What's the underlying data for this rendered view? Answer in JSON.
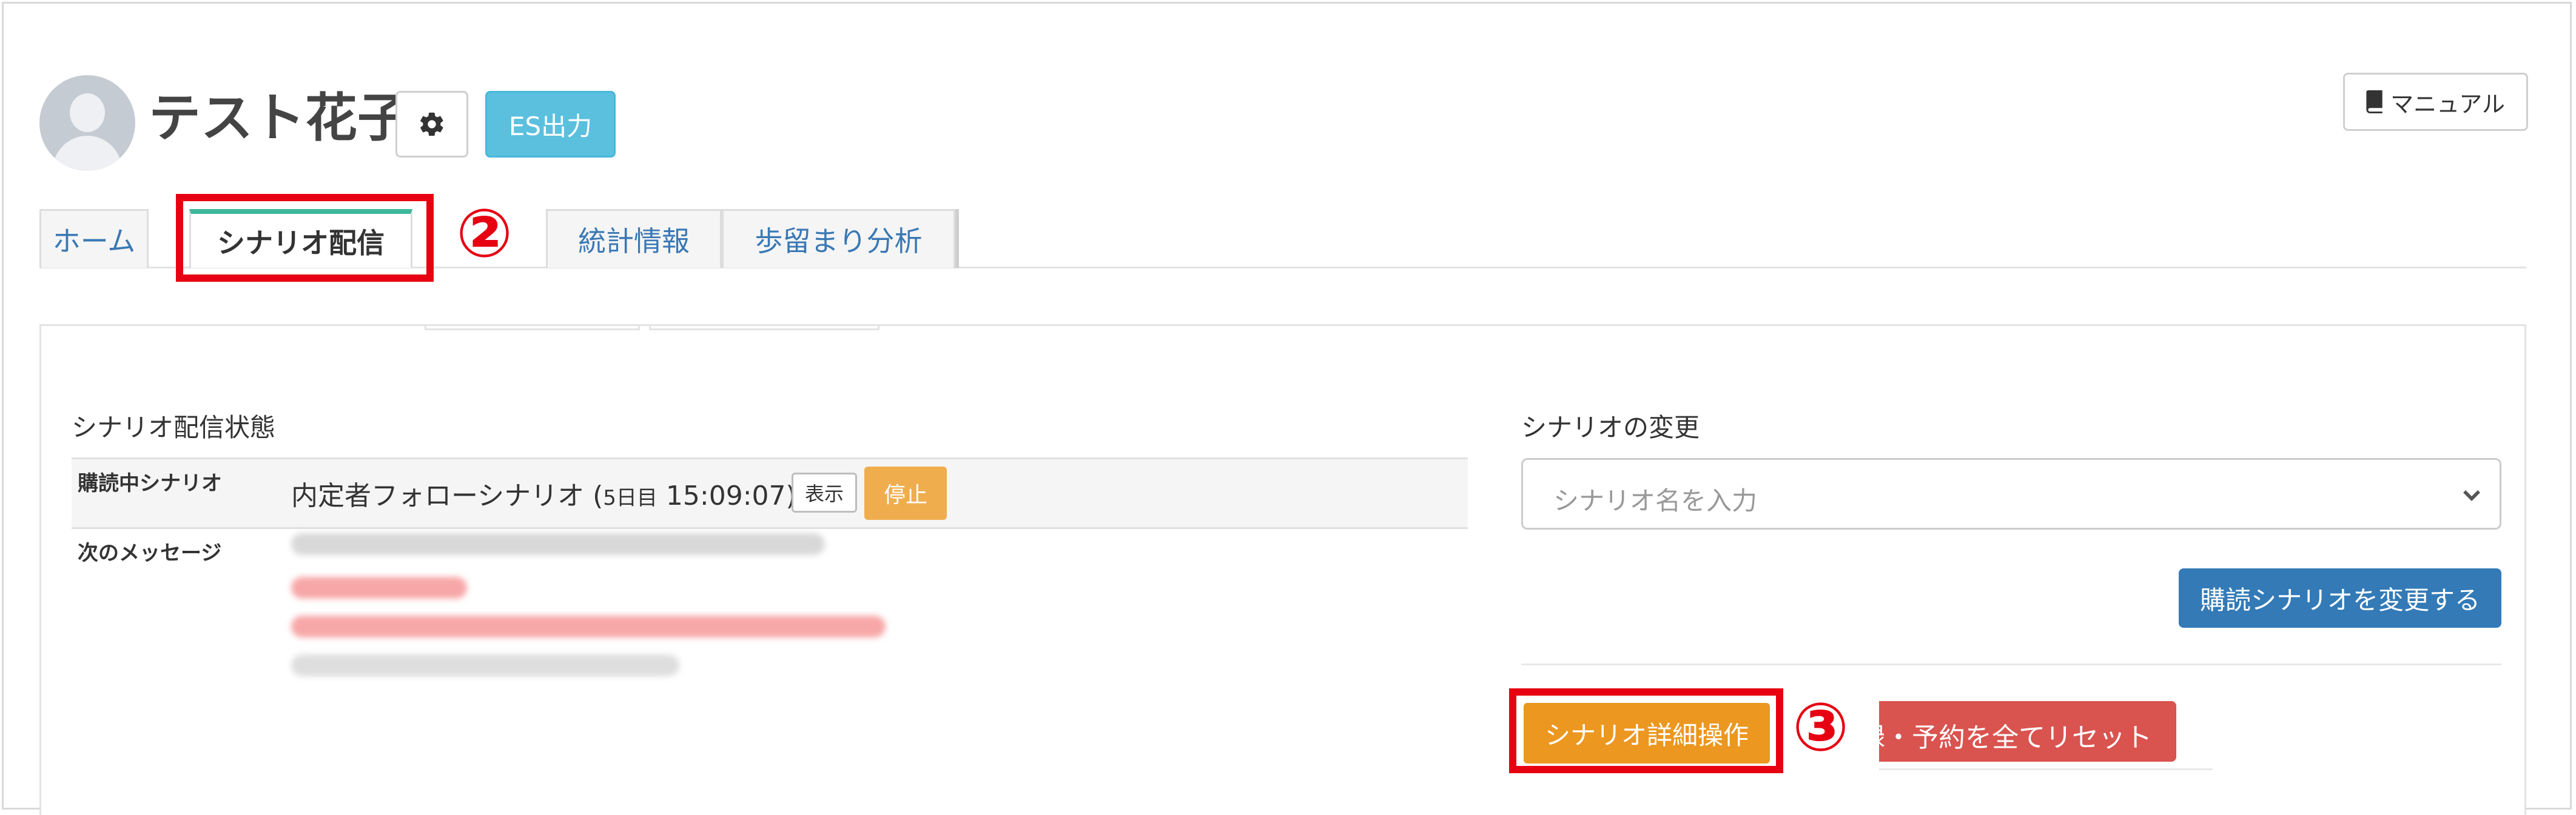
{
  "header": {
    "user_name": "テスト花子",
    "es_button": "ES出力",
    "manual_button": "マニュアル"
  },
  "tabs": [
    {
      "label": "ホーム"
    },
    {
      "label": "シナリオ配信"
    },
    {
      "label": "統計情報"
    },
    {
      "label": "歩留まり分析"
    }
  ],
  "annotations": {
    "step2": "②",
    "step3": "③"
  },
  "status": {
    "title": "シナリオ配信状態",
    "reading_label": "購読中シナリオ",
    "scenario_name": "内定者フォローシナリオ (",
    "scenario_day": "5日目",
    "scenario_time": " 15:09:07)",
    "show_button": "表示",
    "stop_button": "停止",
    "next_message_label": "次のメッセージ"
  },
  "change": {
    "title": "シナリオの変更",
    "select_placeholder": "シナリオ名を入力",
    "change_button": "購読シナリオを変更する",
    "detail_button": "シナリオ詳細操作",
    "reset_button": "録・予約を全てリセット"
  },
  "colors": {
    "annotation_red": "#e60012",
    "tab_active_accent": "#3eb89c",
    "info_button": "#5bc0de",
    "primary_button": "#337ab7",
    "warning_button": "#f0ad4e",
    "danger_button": "#d9534f"
  },
  "icons": {
    "settings": "gear-icon",
    "manual": "book-icon",
    "select": "chevron-down-icon",
    "avatar": "user-avatar-icon"
  }
}
